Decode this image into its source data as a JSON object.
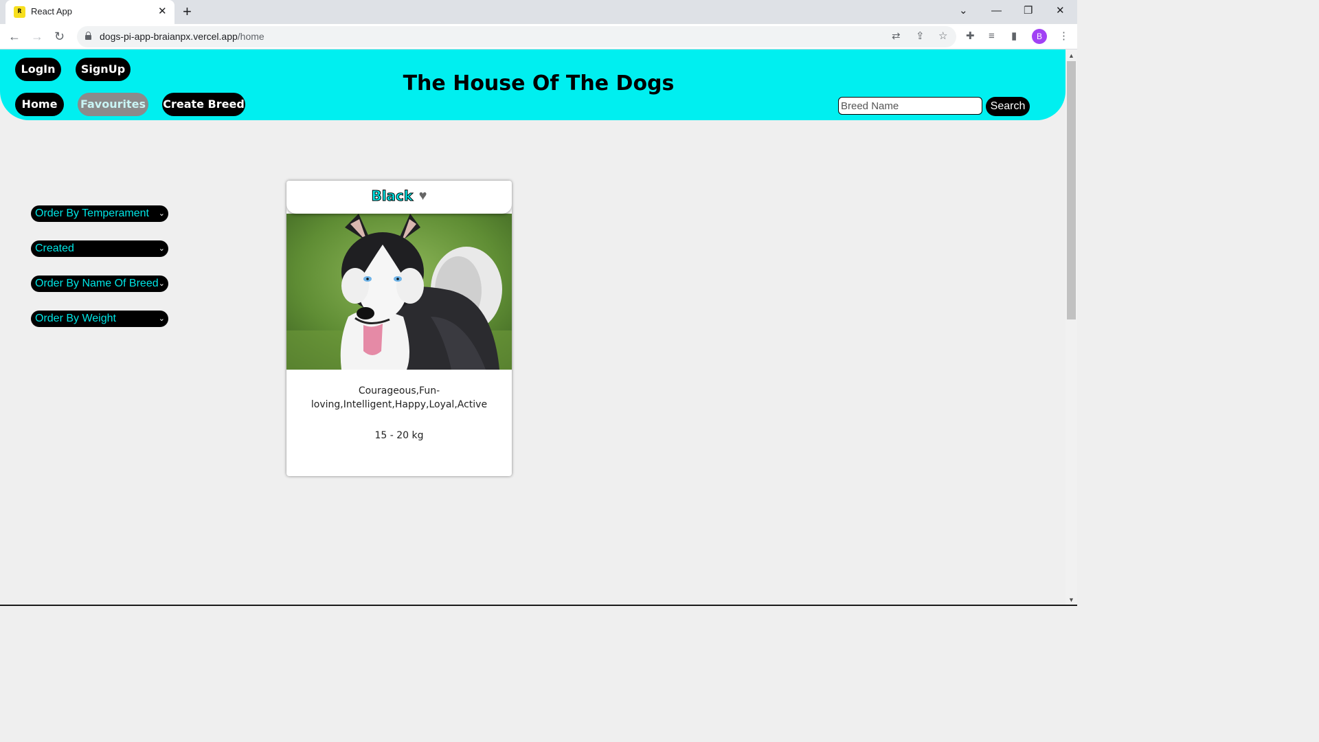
{
  "browser": {
    "tab_title": "React App",
    "favicon_text": "R",
    "url_host": "dogs-pi-app-braianpx.vercel.app",
    "url_path": "/home",
    "profile_initial": "B"
  },
  "header": {
    "title": "The House Of The Dogs",
    "login_label": "LogIn",
    "signup_label": "SignUp",
    "home_label": "Home",
    "favourites_label": "Favourites",
    "create_breed_label": "Create Breed",
    "search_placeholder": "Breed Name",
    "search_label": "Search"
  },
  "filters": [
    {
      "label": "Order By Temperament"
    },
    {
      "label": "Created"
    },
    {
      "label": "Order By Name Of Breed"
    },
    {
      "label": "Order By Weight"
    }
  ],
  "cards": [
    {
      "name": "Black",
      "favourite_symbol": "♥",
      "temperament": "Courageous,Fun-loving,Intelligent,Happy,Loyal,Active",
      "weight": "15 - 20 kg",
      "image_description_icon": "husky-dog-image"
    }
  ],
  "colors": {
    "header_bg": "#00eff0",
    "accent_text": "#00e5e5",
    "button_bg": "#000000",
    "muted_button_bg": "#8b8b8b"
  }
}
